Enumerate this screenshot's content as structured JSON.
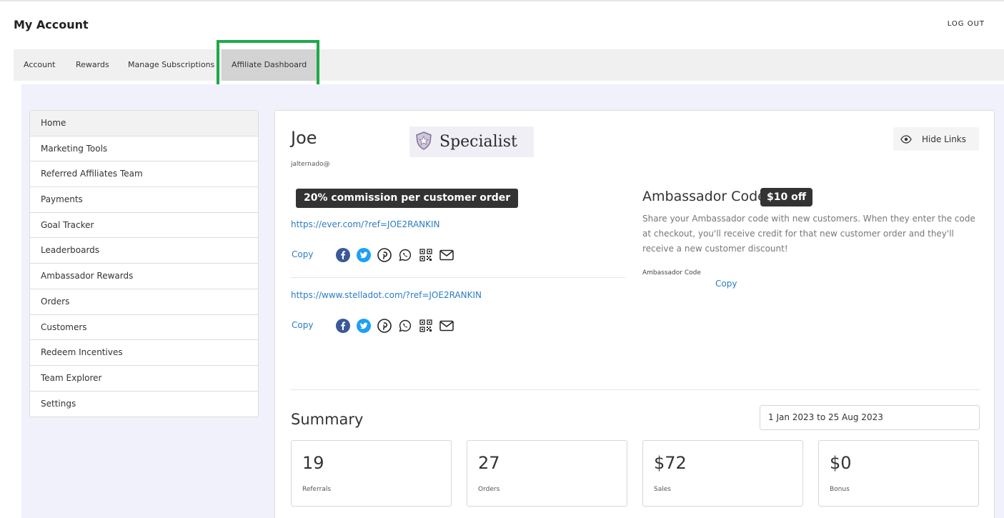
{
  "header": {
    "title": "My Account",
    "logout_label": "LOG OUT"
  },
  "tabs": [
    {
      "label": "Account"
    },
    {
      "label": "Rewards"
    },
    {
      "label": "Manage Subscriptions"
    },
    {
      "label": "Affiliate Dashboard",
      "active": true
    }
  ],
  "sidebar": {
    "items": [
      {
        "label": "Home",
        "active": true
      },
      {
        "label": "Marketing Tools"
      },
      {
        "label": "Referred Affiliates Team"
      },
      {
        "label": "Payments"
      },
      {
        "label": "Goal Tracker"
      },
      {
        "label": "Leaderboards"
      },
      {
        "label": "Ambassador Rewards"
      },
      {
        "label": "Orders"
      },
      {
        "label": "Customers"
      },
      {
        "label": "Redeem Incentives"
      },
      {
        "label": "Team Explorer"
      },
      {
        "label": "Settings"
      }
    ]
  },
  "profile": {
    "name": "Joe",
    "email": "jalternado@",
    "rank": "Specialist",
    "rank_icon": "shield-star-icon",
    "hide_links_label": "Hide Links",
    "hide_links_icon": "eye-icon"
  },
  "commission": {
    "label": "20% commission per customer order"
  },
  "links": [
    {
      "url": "https://ever.com/?ref=JOE2RANKIN",
      "copy_label": "Copy"
    },
    {
      "url": "https://www.stelladot.com/?ref=JOE2RANKIN",
      "copy_label": "Copy"
    }
  ],
  "share_icons": [
    "facebook-icon",
    "twitter-icon",
    "pinterest-icon",
    "whatsapp-icon",
    "qr-code-icon",
    "email-icon"
  ],
  "ambassador": {
    "title": "Ambassador Code",
    "badge": "$10 off",
    "description": "Share your Ambassador code with new customers. When they enter the code at checkout, you'll receive credit for that new customer order and they'll receive a new customer discount!",
    "code_label": "Ambassador Code",
    "copy_label": "Copy"
  },
  "summary": {
    "title": "Summary",
    "date_range": "1 Jan 2023 to 25 Aug 2023",
    "stats": [
      {
        "value": "19",
        "label": "Referrals"
      },
      {
        "value": "27",
        "label": "Orders"
      },
      {
        "value": "$72",
        "label": "Sales"
      },
      {
        "value": "$0",
        "label": "Bonus"
      }
    ]
  },
  "colors": {
    "link": "#2b7cc7",
    "highlight": "#1fa84a",
    "content_bg": "#f1f1fc",
    "badge_bg": "#333333",
    "facebook": "#3b5998",
    "twitter": "#1da1f2"
  }
}
